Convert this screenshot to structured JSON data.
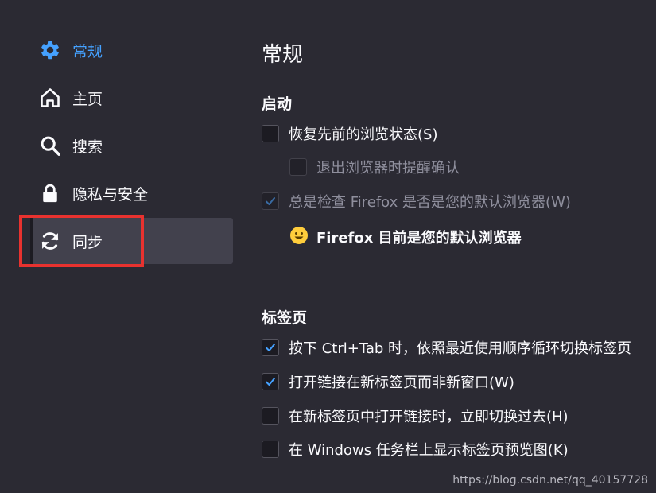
{
  "sidebar": {
    "items": [
      {
        "label": "常规",
        "icon": "gear-icon",
        "active": true
      },
      {
        "label": "主页",
        "icon": "home-icon"
      },
      {
        "label": "搜索",
        "icon": "search-icon"
      },
      {
        "label": "隐私与安全",
        "icon": "lock-icon"
      },
      {
        "label": "同步",
        "icon": "sync-icon",
        "selected": true
      }
    ]
  },
  "main": {
    "title": "常规",
    "startup": {
      "heading": "启动",
      "restore_session": {
        "label": "恢复先前的浏览状态(S)",
        "checked": false
      },
      "warn_on_quit": {
        "label": "退出浏览器时提醒确认",
        "checked": false,
        "disabled": true
      },
      "check_default": {
        "label": "总是检查 Firefox 是否是您的默认浏览器(W)",
        "checked": true,
        "disabled": true
      },
      "default_status": "Firefox 目前是您的默认浏览器"
    },
    "tabs": {
      "heading": "标签页",
      "options": [
        {
          "label": "按下 Ctrl+Tab 时，依照最近使用顺序循环切换标签页",
          "checked": true
        },
        {
          "label": "打开链接在新标签页而非新窗口(W)",
          "checked": true
        },
        {
          "label": "在新标签页中打开链接时，立即切换过去(H)",
          "checked": false
        },
        {
          "label": "在 Windows 任务栏上显示标签页预览图(K)",
          "checked": false
        }
      ]
    }
  },
  "watermark": "https://blog.csdn.net/qq_40157728",
  "colors": {
    "background": "#2b2a33",
    "accent": "#45a1ff",
    "checkbox_bg": "#1c1b22",
    "selected_item_bg": "#42414d",
    "highlight_border": "#e8322f"
  }
}
